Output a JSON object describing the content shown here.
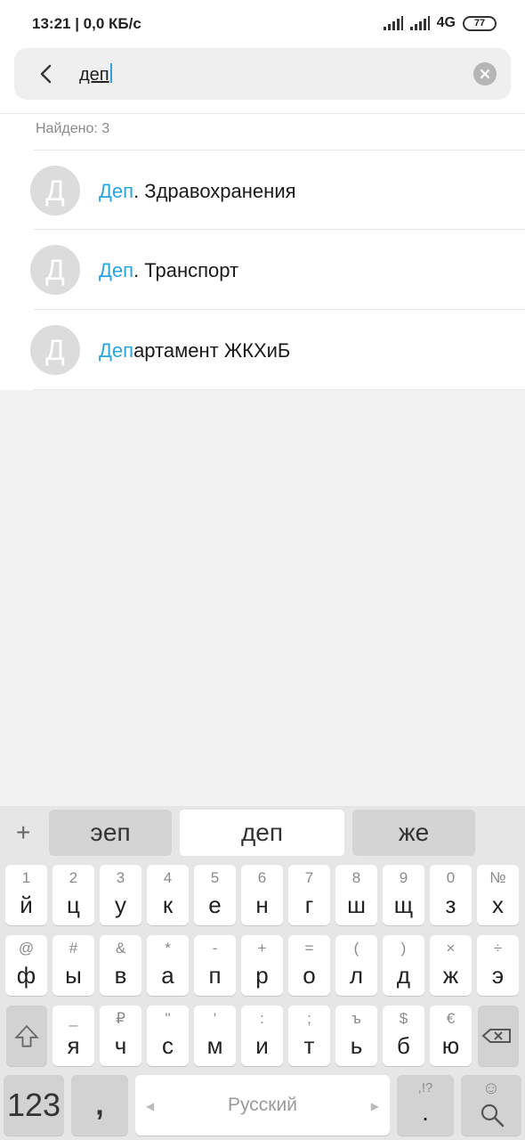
{
  "status_bar": {
    "time": "13:21 | 0,0 КБ/с",
    "network": "4G",
    "battery": "77"
  },
  "search": {
    "query": "деп"
  },
  "results": {
    "found_label": "Найдено: 3",
    "items": [
      {
        "avatar": "Д",
        "highlight": "Деп",
        "rest": ". Здравохранения"
      },
      {
        "avatar": "Д",
        "highlight": "Деп",
        "rest": ". Транспорт"
      },
      {
        "avatar": "Д",
        "highlight": "Деп",
        "rest": "артамент ЖКХиБ"
      }
    ]
  },
  "keyboard": {
    "plus": "+",
    "suggestions": [
      "эеп",
      "деп",
      "же"
    ],
    "row1": [
      {
        "alt": "1",
        "main": "й"
      },
      {
        "alt": "2",
        "main": "ц"
      },
      {
        "alt": "3",
        "main": "у"
      },
      {
        "alt": "4",
        "main": "к"
      },
      {
        "alt": "5",
        "main": "е"
      },
      {
        "alt": "6",
        "main": "н"
      },
      {
        "alt": "7",
        "main": "г"
      },
      {
        "alt": "8",
        "main": "ш"
      },
      {
        "alt": "9",
        "main": "щ"
      },
      {
        "alt": "0",
        "main": "з"
      },
      {
        "alt": "№",
        "main": "х"
      }
    ],
    "row2": [
      {
        "alt": "@",
        "main": "ф"
      },
      {
        "alt": "#",
        "main": "ы"
      },
      {
        "alt": "&",
        "main": "в"
      },
      {
        "alt": "*",
        "main": "а"
      },
      {
        "alt": "-",
        "main": "п"
      },
      {
        "alt": "+",
        "main": "р"
      },
      {
        "alt": "=",
        "main": "о"
      },
      {
        "alt": "(",
        "main": "л"
      },
      {
        "alt": ")",
        "main": "д"
      },
      {
        "alt": "×",
        "main": "ж"
      },
      {
        "alt": "÷",
        "main": "э"
      }
    ],
    "row3": [
      {
        "alt": "_",
        "main": "я"
      },
      {
        "alt": "₽",
        "main": "ч"
      },
      {
        "alt": "\"",
        "main": "с"
      },
      {
        "alt": "'",
        "main": "м"
      },
      {
        "alt": ":",
        "main": "и"
      },
      {
        "alt": ";",
        "main": "т"
      },
      {
        "alt": "ъ",
        "main": "ь"
      },
      {
        "alt": "$",
        "main": "б"
      },
      {
        "alt": "€",
        "main": "ю"
      }
    ],
    "bottom": {
      "numbers": "123",
      "comma": ",",
      "space": "Русский",
      "punct_alt": ",!?",
      "punct_main": ".",
      "emoji_alt": "☺"
    }
  }
}
